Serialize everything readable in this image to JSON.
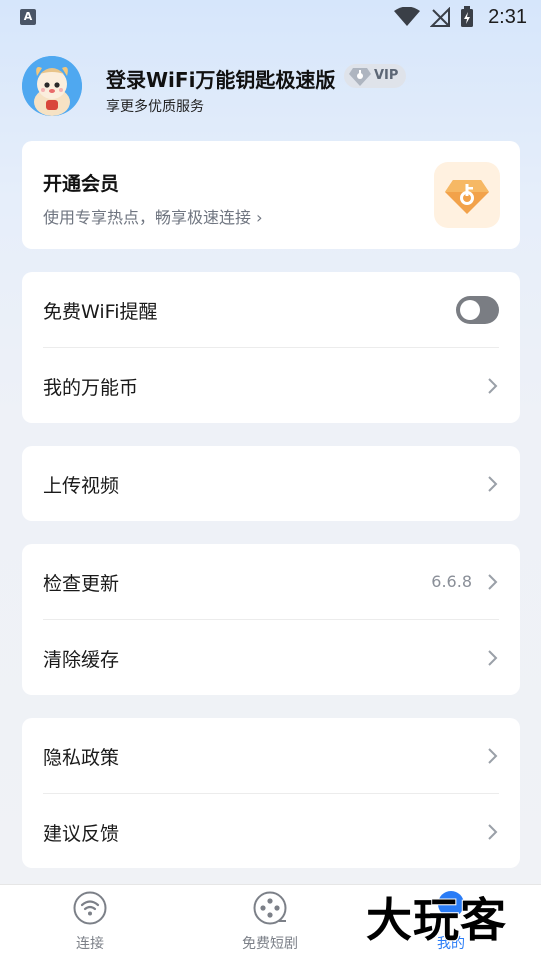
{
  "status_bar": {
    "app_icon_letter": "A",
    "time": "2:31"
  },
  "profile": {
    "name": "登录WiFi万能钥匙极速版",
    "vip_badge": "VIP",
    "subtitle": "享更多优质服务"
  },
  "vip_card": {
    "title": "开通会员",
    "description": "使用专享热点，畅享极速连接 ›"
  },
  "settings": {
    "wifi_reminder": {
      "label": "免费WiFi提醒",
      "enabled": false
    },
    "coins": {
      "label": "我的万能币"
    },
    "upload_video": {
      "label": "上传视频"
    },
    "check_update": {
      "label": "检查更新",
      "value": "6.6.8"
    },
    "clear_cache": {
      "label": "清除缓存"
    },
    "privacy": {
      "label": "隐私政策"
    },
    "feedback": {
      "label": "建议反馈"
    }
  },
  "bottom_nav": {
    "items": [
      {
        "label": "连接",
        "icon": "wifi-icon"
      },
      {
        "label": "免费短剧",
        "icon": "film-reel-icon"
      },
      {
        "label": "我的",
        "icon": "profile-icon",
        "active": true
      }
    ]
  },
  "watermark": "大玩客",
  "colors": {
    "accent": "#2a7cf6",
    "vip_orange": "#f2a24a",
    "toggle_off": "#7a7d83"
  }
}
